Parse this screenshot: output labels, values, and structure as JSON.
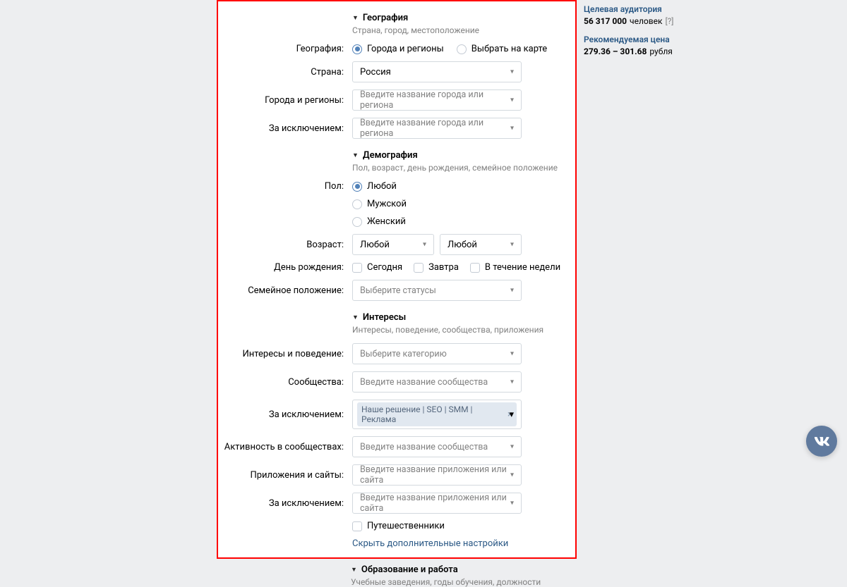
{
  "sections": {
    "geo": {
      "title": "География",
      "subtitle": "Страна, город, местоположение",
      "label_geography": "География:",
      "radio_cities": "Города и регионы",
      "radio_map": "Выбрать на карте",
      "label_country": "Страна:",
      "country_value": "Россия",
      "label_cities_regions": "Города и регионы:",
      "cities_placeholder": "Введите название города или региона",
      "label_except": "За исключением:",
      "except_placeholder": "Введите название города или региона"
    },
    "demo": {
      "title": "Демография",
      "subtitle": "Пол, возраст, день рождения, семейное положение",
      "label_sex": "Пол:",
      "sex_any": "Любой",
      "sex_male": "Мужской",
      "sex_female": "Женский",
      "label_age": "Возраст:",
      "age_from": "Любой",
      "age_to": "Любой",
      "label_birthday": "День рождения:",
      "bday_today": "Сегодня",
      "bday_tomorrow": "Завтра",
      "bday_week": "В течение недели",
      "label_marital": "Семейное положение:",
      "marital_placeholder": "Выберите статусы"
    },
    "interests": {
      "title": "Интересы",
      "subtitle": "Интересы, поведение, сообщества, приложения",
      "label_interests_behavior": "Интересы и поведение:",
      "interests_placeholder": "Выберите категорию",
      "label_communities": "Сообщества:",
      "communities_placeholder": "Введите название сообщества",
      "label_except": "За исключением:",
      "except_token": "Наше решение | SEO | SMM | Реклама",
      "label_activity": "Активность в сообществах:",
      "activity_placeholder": "Введите название сообщества",
      "label_apps": "Приложения и сайты:",
      "apps_placeholder": "Введите название приложения или сайта",
      "label_apps_except": "За исключением:",
      "apps_except_placeholder": "Введите название приложения или сайта",
      "travelers": "Путешественники",
      "hide_link": "Скрыть дополнительные настройки"
    },
    "edu": {
      "title": "Образование и работа",
      "subtitle": "Учебные заведения, годы обучения, должности"
    }
  },
  "sidebar": {
    "audience_title": "Целевая аудитория",
    "audience_value": "56 317 000",
    "audience_unit": "человек",
    "audience_help": "[?]",
    "price_title": "Рекомендуемая цена",
    "price_value": "279.36 – 301.68",
    "price_unit": "рубля"
  }
}
